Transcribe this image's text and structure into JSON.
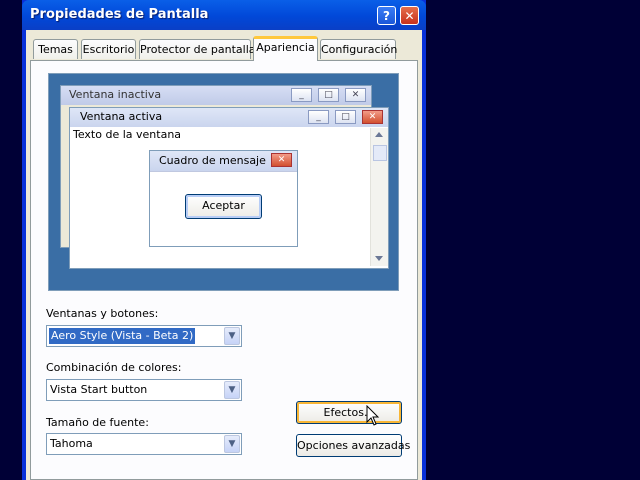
{
  "dialog": {
    "title": "Propiedades de Pantalla",
    "help_label": "?",
    "close_label": "✕"
  },
  "tabs": [
    {
      "label": "Temas"
    },
    {
      "label": "Escritorio"
    },
    {
      "label": "Protector de pantalla"
    },
    {
      "label": "Apariencia",
      "active": true
    },
    {
      "label": "Configuración"
    }
  ],
  "preview": {
    "inactive_title": "Ventana inactiva",
    "active_title": "Ventana activa",
    "window_text": "Texto de la ventana",
    "message_title": "Cuadro de mensaje",
    "accept_label": "Aceptar",
    "min_glyph": "_",
    "max_glyph": "□",
    "close_glyph": "✕"
  },
  "fields": {
    "windows_buttons": {
      "label": "Ventanas y botones:",
      "value": "Aero Style (Vista - Beta 2)"
    },
    "color_scheme": {
      "label": "Combinación de colores:",
      "value": "Vista Start button"
    },
    "font_size": {
      "label": "Tamaño de fuente:",
      "value": "Tahoma"
    }
  },
  "buttons": {
    "effects": "Efectos...",
    "advanced": "Opciones avanzadas"
  },
  "icons": {
    "combo_arrow": "chevron-down-icon",
    "scroll_up": "scroll-up-icon",
    "scroll_down": "scroll-down-icon",
    "cursor": "mouse-pointer-icon"
  },
  "colors": {
    "desktop": "#000036",
    "titlebar": "#0148d8",
    "preview_bg": "#3a6ea5",
    "selection": "#316ac5",
    "active_tab_accent": "#ffc83c"
  }
}
